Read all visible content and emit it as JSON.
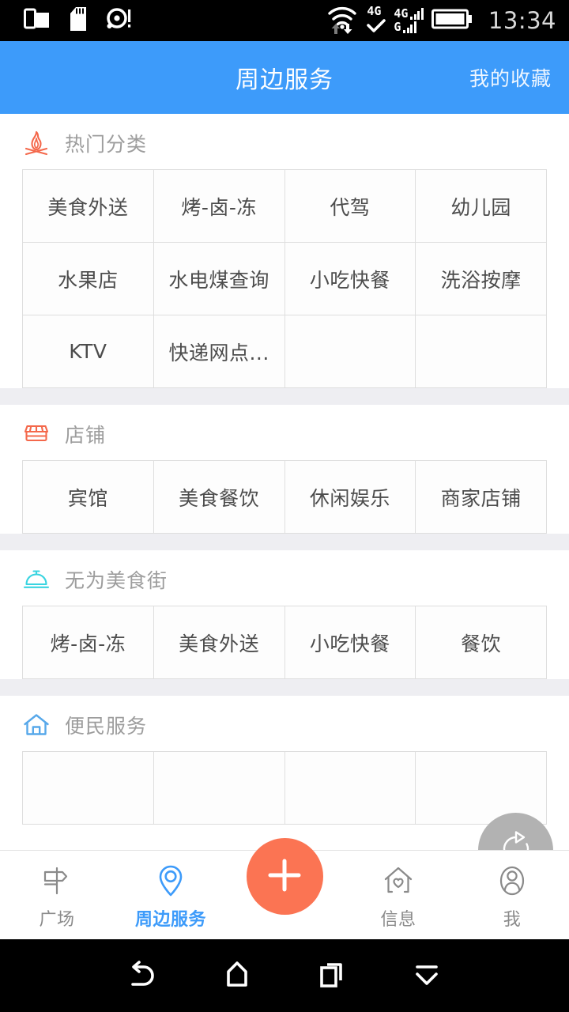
{
  "status_bar": {
    "left_icons": [
      "dual-window-icon",
      "sd-card-icon",
      "disc-alert-icon"
    ],
    "wifi_icon": "wifi-icon",
    "network_label_1": "4G",
    "network_check_icon": "check-icon",
    "network_label_2": "4G",
    "network_label_3": "G",
    "battery_icon": "battery-full-icon",
    "clock": "13:34"
  },
  "header": {
    "title": "周边服务",
    "favorites_label": "我的收藏",
    "background_color": "#3d9bfa"
  },
  "sections": [
    {
      "id": "hot-categories",
      "icon": "campfire-icon",
      "icon_color": "#f4684b",
      "title": "热门分类",
      "cells": [
        "美食外送",
        "烤-卤-冻",
        "代驾",
        "幼儿园",
        "水果店",
        "水电煤查询",
        "小吃快餐",
        "洗浴按摩",
        "KTV",
        "快递网点...",
        "",
        ""
      ]
    },
    {
      "id": "shops",
      "icon": "storefront-icon",
      "icon_color": "#f4684b",
      "title": "店铺",
      "cells": [
        "宾馆",
        "美食餐饮",
        "休闲娱乐",
        "商家店铺"
      ]
    },
    {
      "id": "wuwei-food-street",
      "icon": "service-bell-icon",
      "icon_color": "#39d4e0",
      "title": "无为美食街",
      "cells": [
        "烤-卤-冻",
        "美食外送",
        "小吃快餐",
        "餐饮"
      ]
    },
    {
      "id": "convenience-services",
      "icon": "house-icon",
      "icon_color": "#57a8ea",
      "title": "便民服务",
      "cells": []
    }
  ],
  "refresh_button": {
    "icon": "refresh-icon",
    "color": "#b2b2b2"
  },
  "bottom_nav": {
    "accent_color": "#3d9bfa",
    "add_color": "#fb7453",
    "items": [
      {
        "icon": "signpost-icon",
        "label": "广场",
        "active": false
      },
      {
        "icon": "location-pin-icon",
        "label": "周边服务",
        "active": true
      },
      {
        "icon": "plus-icon",
        "label": "",
        "active": false
      },
      {
        "icon": "house-heart-icon",
        "label": "信息",
        "active": false
      },
      {
        "icon": "person-icon",
        "label": "我",
        "active": false
      }
    ]
  },
  "system_nav": {
    "buttons": [
      "back-icon",
      "home-icon",
      "recents-icon",
      "hide-navbar-icon"
    ]
  }
}
